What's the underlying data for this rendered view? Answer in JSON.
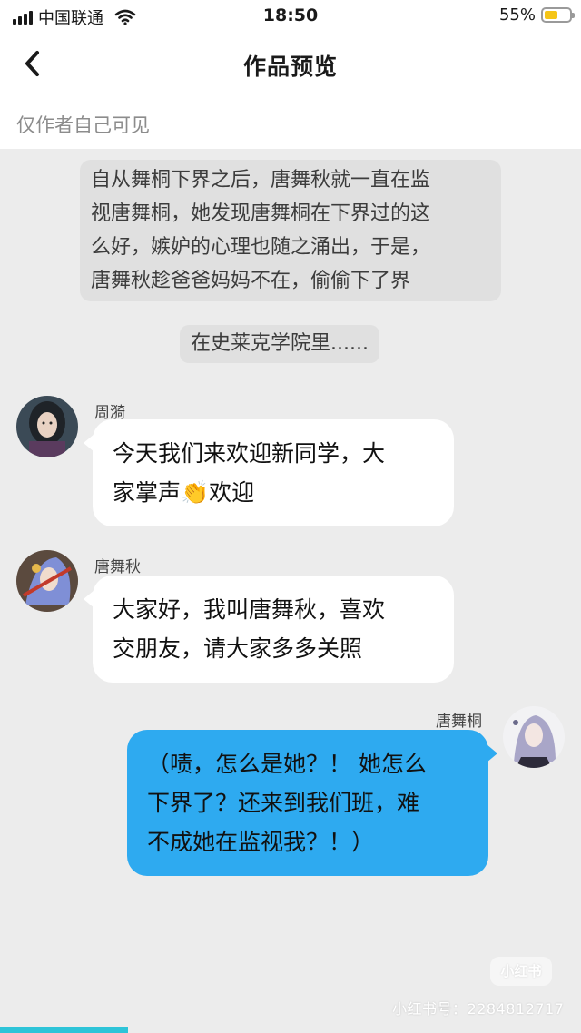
{
  "status_bar": {
    "carrier": "中国联通",
    "time": "18:50",
    "battery_percent_text": "55%",
    "battery_level": 0.55
  },
  "nav": {
    "title": "作品预览",
    "back_icon": "chevron-left-icon"
  },
  "visibility_note": "仅作者自己可见",
  "narration": {
    "lines": [
      "自从舞桐下界之后，唐舞秋就一直在监",
      "视唐舞桐，她发现唐舞桐在下界过的这",
      "么好，嫉妒的心理也随之涌出，于是，",
      "唐舞秋趁爸爸妈妈不在，偷偷下了界"
    ]
  },
  "scene_note": "在史莱克学院里......",
  "messages": [
    {
      "sender": "周漪",
      "side": "left",
      "lines": [
        "今天我们来欢迎新同学，大",
        "家掌声👏欢迎"
      ]
    },
    {
      "sender": "唐舞秋",
      "side": "left",
      "lines": [
        "大家好，我叫唐舞秋，喜欢",
        "交朋友，请大家多多关照"
      ]
    },
    {
      "sender": "唐舞桐",
      "side": "right",
      "lines": [
        "（啧，怎么是她？！ 她怎么",
        "下界了？还来到我们班，难",
        "不成她在监视我？！）"
      ]
    }
  ],
  "watermark": {
    "logo_text": "小红书",
    "id_text": "小红书号：2284812717"
  },
  "colors": {
    "accent_bubble": "#2eaaf0",
    "progress": "#2ec4d8",
    "battery": "#f5c517"
  },
  "progress_fraction": 0.22
}
